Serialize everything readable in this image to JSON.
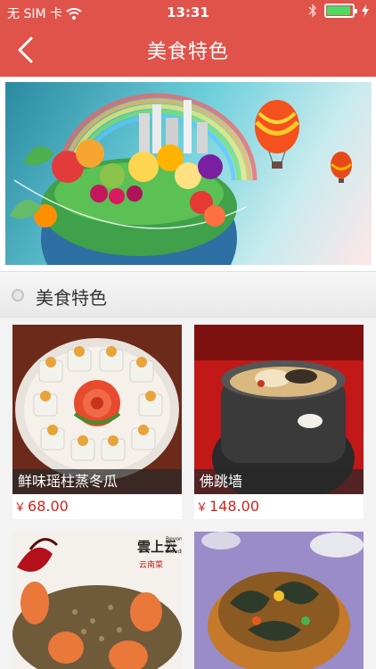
{
  "status": {
    "carrier": "无 SIM 卡",
    "time": "13:31",
    "wifi_icon": "wifi-icon",
    "bluetooth_icon": "bluetooth-icon",
    "battery_icon": "battery-icon",
    "charging_icon": "charging-bolt-icon"
  },
  "navbar": {
    "title": "美食特色",
    "back_icon": "chevron-left-icon",
    "background": "#e0534a"
  },
  "section": {
    "title": "美食特色"
  },
  "items": [
    {
      "name": "鲜味瑶柱蒸冬瓜",
      "currency": "￥",
      "price": "68.00"
    },
    {
      "name": "佛跳墙",
      "currency": "￥",
      "price": "148.00"
    },
    {
      "name": "",
      "currency": "",
      "price": "",
      "logo_text": "Beyond The Clouds"
    },
    {
      "name": "",
      "currency": "",
      "price": ""
    }
  ],
  "colors": {
    "accent": "#e0534a",
    "price": "#d2231f"
  }
}
